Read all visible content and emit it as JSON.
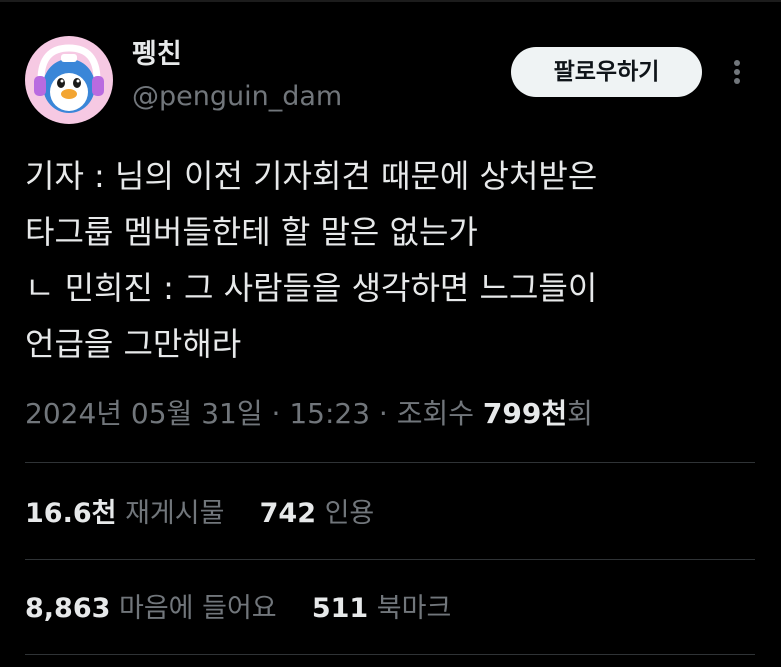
{
  "user": {
    "display_name": "펭친",
    "handle": "@penguin_dam",
    "avatar_icon": "penguin-avatar-icon"
  },
  "follow_label": "팔로우하기",
  "more_icon": "more-options-icon",
  "tweet": {
    "lines": [
      "기자 : 님의 이전 기자회견 때문에 상처받은",
      "타그룹 멤버들한테 할 말은 없는가",
      "ㄴ 민희진 : 그 사람들을 생각하면 느그들이",
      "언급을 그만해라"
    ]
  },
  "meta": {
    "date": "2024년 05월 31일",
    "sep": " · ",
    "time": "15:23",
    "views_label": "조회수",
    "views_count": "799천",
    "views_suffix": "회"
  },
  "stats": {
    "retweets_count": "16.6천",
    "retweets_label": "재게시물",
    "quotes_count": "742",
    "quotes_label": "인용",
    "likes_count": "8,863",
    "likes_label": "마음에 들어요",
    "bookmarks_count": "511",
    "bookmarks_label": "북마크"
  },
  "colors": {
    "background": "#000000",
    "text_primary": "#e7e9ea",
    "text_secondary": "#71767b",
    "divider": "#2f3336",
    "button_bg": "#eff3f4",
    "avatar_bg": "#f7c4e0"
  }
}
